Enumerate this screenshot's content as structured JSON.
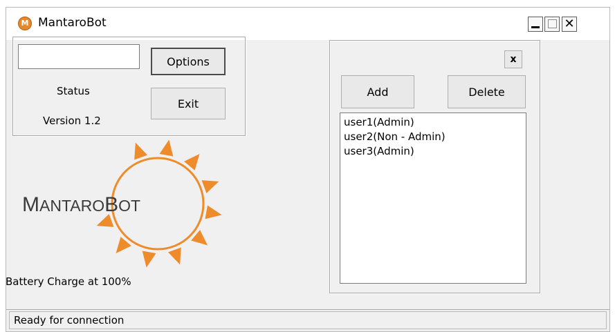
{
  "window": {
    "title": "MantaroBot",
    "icon_letter": "M"
  },
  "controls": {
    "text_field_value": "",
    "options_label": "Options",
    "exit_label": "Exit",
    "status_label": "Status",
    "version_label": "Version 1.2"
  },
  "logo": {
    "text": "MantaroBot",
    "accent_color": "#ee8b2b"
  },
  "battery_text": "Battery Charge at 100%",
  "users_panel": {
    "close_label": "x",
    "add_label": "Add",
    "delete_label": "Delete",
    "items": [
      {
        "label": "user1(Admin)"
      },
      {
        "label": "user2(Non - Admin)"
      },
      {
        "label": "user3(Admin)"
      }
    ]
  },
  "status_bar": {
    "text": "Ready for connection"
  },
  "icons": {
    "minimize": "minimize-icon",
    "maximize": "maximize-icon",
    "close": "close-icon"
  }
}
